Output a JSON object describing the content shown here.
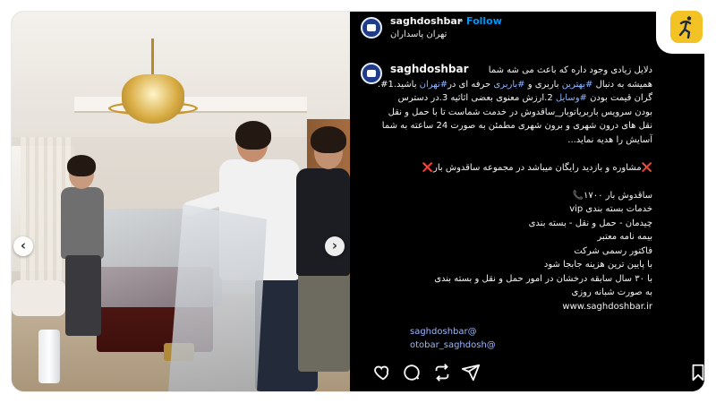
{
  "post": {
    "username": "saghdoshbar",
    "separator": "•",
    "follow_label": "Follow",
    "location": "تهران پاسداران"
  },
  "caption": {
    "username": "saghdoshbar",
    "lines": [
      "دلایل زیادی وجود داره که باعث می شه شما",
      "همیشه به دنبال #بهترین باربری و #باربری حرفه ای در#تهران باشید.1#.",
      "گران قیمت بودن #وسایل 2.ارزش معنوی بعضی اثاثیه 3.در دسترس",
      "بودن سرویس باربر‌یاتوبار_ساقدوش در خدمت شماست تا با حمل و نقل",
      "نقل های درون شهری و برون شهری مطمئن به صورت 24 ساعته به شما",
      "آسایش را هدیه نماید...",
      "",
      "❌مشاوره و بازدید رایگان میباشد در مجموعه ساقدوش بار❌",
      "",
      "ساقدوش بار ۱۷۰۰📞",
      "خدمات بسته بندی vip",
      "چیدمان - حمل و نقل - بسته بندی",
      "بیمه نامه معتبر",
      "فاکتور رسمی شرکت",
      "با پایین ترین هزینه جابجا شود",
      "با ۳۰ سال سابقه درخشان در امور حمل و نقل و بسته بندی",
      "به صورت شبانه روزی",
      "www.saghdoshbar.ir"
    ],
    "mentions": [
      "saghdoshbar@",
      "otobar_saghdosh@"
    ]
  },
  "carousel": {
    "prev_label": "‹",
    "next_label": "›"
  },
  "actions": {
    "icons": [
      "heart-icon",
      "comment-icon",
      "repost-icon",
      "send-icon",
      "bookmark-icon"
    ]
  },
  "colors": {
    "panel_bg": "#000000",
    "follow": "#0095f6",
    "hashtag": "#8ab4ff",
    "cross": "#e4344a",
    "badge_bg": "#f3c325"
  }
}
